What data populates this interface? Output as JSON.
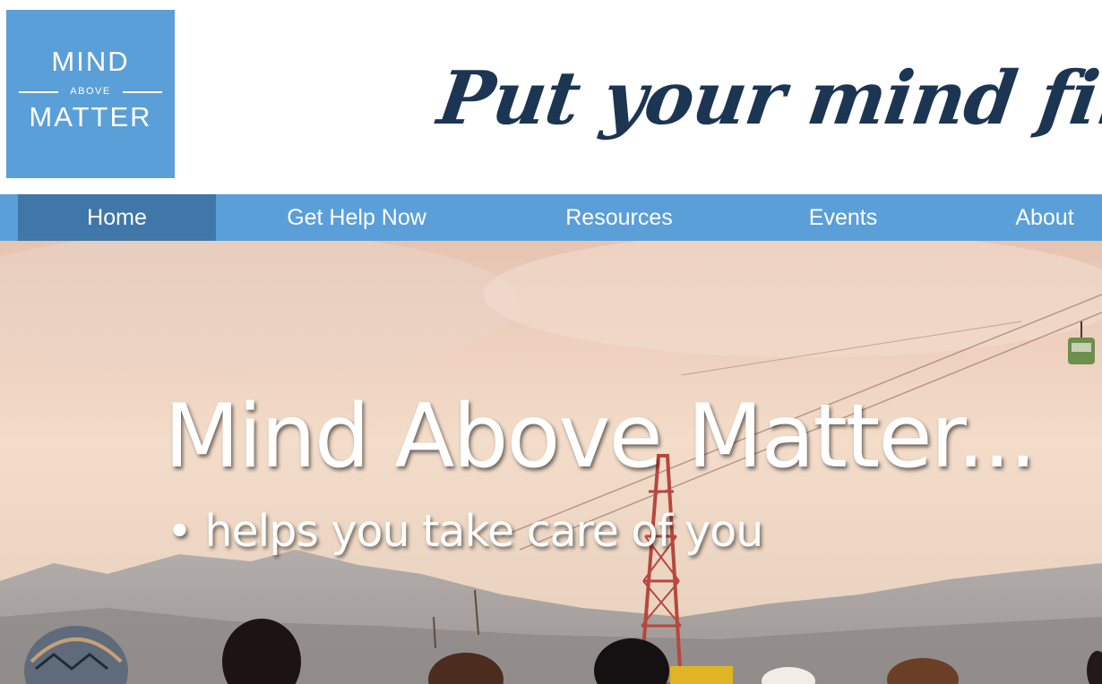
{
  "logo": {
    "top": "MIND",
    "middle": "ABOVE",
    "bottom": "MATTER"
  },
  "tagline": "Put your mind first",
  "nav": {
    "items": [
      {
        "label": "Home",
        "active": true
      },
      {
        "label": "Get Help Now",
        "active": false
      },
      {
        "label": "Resources",
        "active": false
      },
      {
        "label": "Events",
        "active": false
      },
      {
        "label": "About",
        "active": false
      }
    ]
  },
  "hero": {
    "title": "Mind Above Matter...",
    "subtitle": "• helps you take care of you"
  },
  "colors": {
    "brand_blue": "#5b9fd8",
    "nav_active": "#3f77a8",
    "tagline_navy": "#1c3553"
  }
}
